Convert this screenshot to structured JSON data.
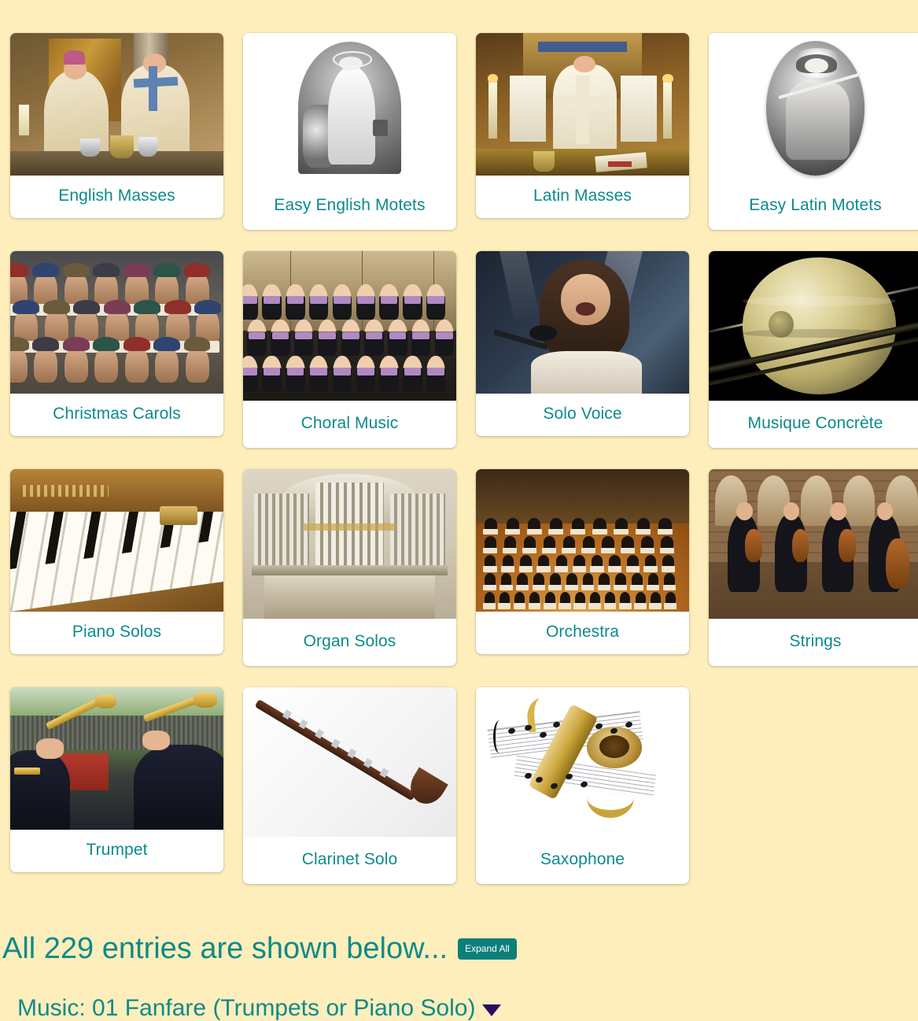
{
  "theme": {
    "page_background": "#fdeebb",
    "card_background": "#ffffff",
    "link_teal": "#0e8a8a",
    "button_teal": "#0d7f7b",
    "caret_purple": "#2b0a63"
  },
  "categories": [
    {
      "label": "English Masses",
      "art": "art-english-mass",
      "fit": "cover",
      "row": 1,
      "col": 1
    },
    {
      "label": "Easy English Motets",
      "art": "art-motet-en",
      "fit": "contain",
      "row": 1,
      "col": 2
    },
    {
      "label": "Latin Masses",
      "art": "art-latin-mass",
      "fit": "cover",
      "row": 1,
      "col": 3
    },
    {
      "label": "Easy Latin Motets",
      "art": "art-motet-la",
      "fit": "contain",
      "row": 1,
      "col": 4
    },
    {
      "label": "Christmas Carols",
      "art": "art-carols",
      "fit": "cover",
      "row": 2,
      "col": 1
    },
    {
      "label": "Choral Music",
      "art": "art-choral",
      "fit": "cover",
      "row": 2,
      "col": 2
    },
    {
      "label": "Solo Voice",
      "art": "art-solovoice",
      "fit": "cover",
      "row": 2,
      "col": 3
    },
    {
      "label": "Musique Concrète",
      "art": "art-saturn",
      "fit": "cover",
      "row": 2,
      "col": 4
    },
    {
      "label": "Piano Solos",
      "art": "art-piano",
      "fit": "cover",
      "row": 3,
      "col": 1
    },
    {
      "label": "Organ Solos",
      "art": "art-organ",
      "fit": "cover",
      "row": 3,
      "col": 2
    },
    {
      "label": "Orchestra",
      "art": "art-orchestra",
      "fit": "cover",
      "row": 3,
      "col": 3
    },
    {
      "label": "Strings",
      "art": "art-strings",
      "fit": "cover",
      "row": 3,
      "col": 4
    },
    {
      "label": "Trumpet",
      "art": "art-trumpet",
      "fit": "cover",
      "row": 4,
      "col": 1
    },
    {
      "label": "Clarinet Solo",
      "art": "art-clarinet",
      "fit": "contain",
      "row": 4,
      "col": 2
    },
    {
      "label": "Saxophone",
      "art": "art-sax",
      "fit": "contain",
      "row": 4,
      "col": 3
    }
  ],
  "entries": {
    "heading": "All 229 entries are shown below...",
    "entry_count": 229,
    "expand_all_label": "Expand All",
    "first_entry": {
      "title": "Music: 01 Fanfare (Trumpets or Piano Solo)",
      "caret_icon": "caret-down-icon"
    }
  }
}
